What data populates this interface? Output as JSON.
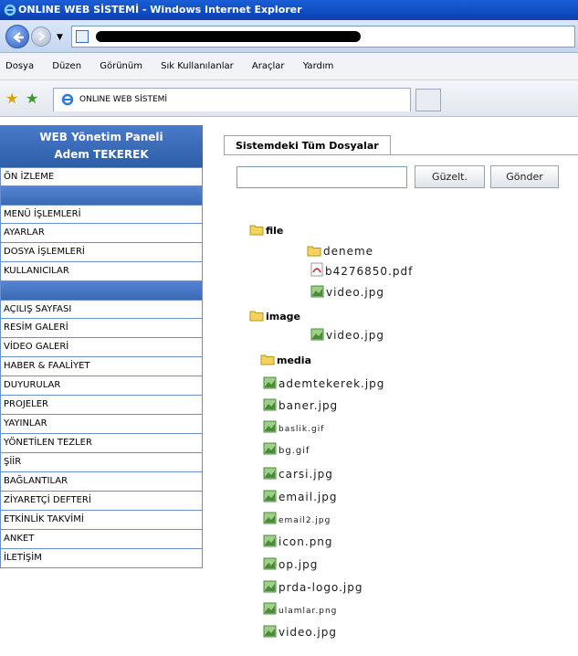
{
  "window": {
    "title": "ONLINE WEB SİSTEMİ - Windows Internet Explorer"
  },
  "menubar": {
    "items": [
      "Dosya",
      "Düzen",
      "Görünüm",
      "Sık Kullanılanlar",
      "Araçlar",
      "Yardım"
    ]
  },
  "browser_tab": {
    "label": "ONLINE WEB SİSTEMİ"
  },
  "sidebar": {
    "header_line1": "WEB Yönetim Paneli",
    "header_line2": "Adem TEKEREK",
    "group1": [
      "ÖN İZLEME"
    ],
    "group2": [
      "MENÜ İŞLEMLERİ",
      "AYARLAR",
      "DOSYA İŞLEMLERİ",
      "KULLANICILAR"
    ],
    "group3": [
      "AÇILIŞ SAYFASI",
      "RESİM GALERİ",
      "VİDEO GALERİ",
      "HABER & FAALİYET",
      "DUYURULAR",
      "PROJELER",
      "YAYINLAR",
      "YÖNETİLEN TEZLER",
      "ŞİİR",
      "BAĞLANTILAR",
      "ZİYARETÇİ DEFTERİ",
      "ETKİNLİK TAKVİMİ",
      "ANKET",
      "İLETİŞİM"
    ]
  },
  "main": {
    "tab_label": "Sistemdeki Tüm Dosyalar",
    "edit_button": "Güzelt.",
    "send_button": "Gönder",
    "tree": {
      "folder_file": "file",
      "folder_deneme": "deneme",
      "file_pdf": "b4276850.pdf",
      "file_video1": "video.jpg",
      "folder_image": "image",
      "file_video2": "video.jpg",
      "folder_media": "media",
      "media_files": [
        "ademtekerek.jpg",
        "baner.jpg",
        "baslik.gif",
        "bg.gif",
        "carsi.jpg",
        "email.jpg",
        "email2.jpg",
        "icon.png",
        "op.jpg",
        "prda-logo.jpg",
        "ulamlar.png",
        "video.jpg"
      ]
    }
  },
  "colors": {
    "titlebar": "#0a3fb3",
    "sidebar_header": "#2d5ea9",
    "sidebar_border": "#6b8fc7"
  }
}
